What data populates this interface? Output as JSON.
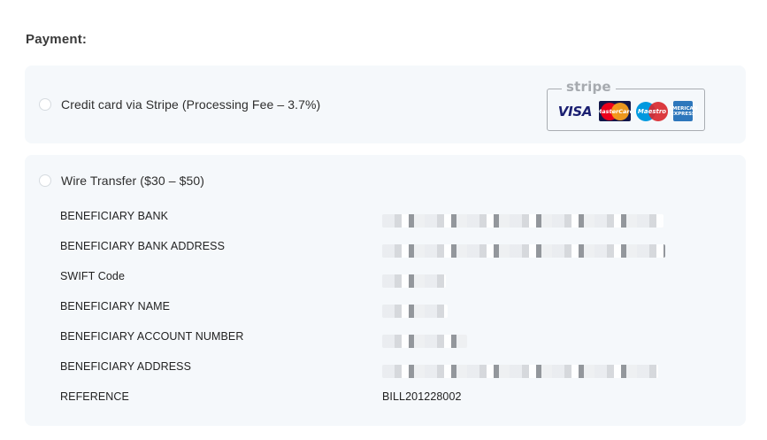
{
  "payment": {
    "title": "Payment:",
    "options": [
      {
        "label": "Credit card via Stripe (Processing Fee – 3.7%)",
        "badge": {
          "brand": "stripe",
          "logos": [
            "visa",
            "mastercard",
            "maestro",
            "amex"
          ],
          "visa_text": "VISA",
          "mastercard_text": "MasterCard",
          "maestro_text": "Maestro",
          "amex_text": [
            "AMERICAN",
            "EXPRESS"
          ]
        }
      },
      {
        "label": "Wire Transfer ($30 – $50)",
        "details": [
          {
            "key": "BENEFICIARY BANK",
            "value": ""
          },
          {
            "key": "BENEFICIARY BANK ADDRESS",
            "value": ""
          },
          {
            "key": "SWIFT Code",
            "value": ""
          },
          {
            "key": "BENEFICIARY NAME",
            "value": ""
          },
          {
            "key": "BENEFICIARY ACCOUNT NUMBER",
            "value": ""
          },
          {
            "key": "BENEFICIARY ADDRESS",
            "value": ""
          },
          {
            "key": "REFERENCE",
            "value": "BILL201228002"
          }
        ]
      }
    ]
  },
  "colors": {
    "card_bg": "#f5f8fb",
    "text": "#2e2e2e",
    "stripe_gray": "#a6aaaf",
    "visa_blue": "#1a1f71",
    "mc_red": "#eb001b",
    "mc_orange": "#f79e1b",
    "maestro_blue": "#0099df",
    "amex_blue": "#2e77bc"
  }
}
